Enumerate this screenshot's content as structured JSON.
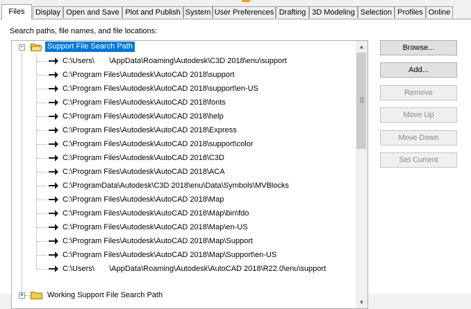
{
  "tabs": [
    {
      "label": "Files",
      "active": true
    },
    {
      "label": "Display"
    },
    {
      "label": "Open and Save"
    },
    {
      "label": "Plot and Publish"
    },
    {
      "label": "System"
    },
    {
      "label": "User Preferences"
    },
    {
      "label": "Drafting"
    },
    {
      "label": "3D Modeling"
    },
    {
      "label": "Selection"
    },
    {
      "label": "Profiles"
    },
    {
      "label": "Online"
    }
  ],
  "panel": {
    "label": "Search paths, file names, and file locations:"
  },
  "tree": {
    "root": {
      "label": "Support File Search Path",
      "expanded": true,
      "selected": true
    },
    "paths": [
      "C:\\Users\\       \\AppData\\Roaming\\Autodesk\\C3D 2018\\enu\\support",
      "C:\\Program Files\\Autodesk\\AutoCAD 2018\\support",
      "C:\\Program Files\\Autodesk\\AutoCAD 2018\\support\\en-US",
      "C:\\Program Files\\Autodesk\\AutoCAD 2018\\fonts",
      "C:\\Program Files\\Autodesk\\AutoCAD 2018\\help",
      "C:\\Program Files\\Autodesk\\AutoCAD 2018\\Express",
      "C:\\Program Files\\Autodesk\\AutoCAD 2018\\support\\color",
      "C:\\Program Files\\Autodesk\\AutoCAD 2018\\C3D",
      "C:\\Program Files\\Autodesk\\AutoCAD 2018\\ACA",
      "C:\\ProgramData\\Autodesk\\C3D 2018\\enu\\Data\\Symbols\\MVBlocks",
      "C:\\Program Files\\Autodesk\\AutoCAD 2018\\Map",
      "C:\\Program Files\\Autodesk\\AutoCAD 2018\\Map\\bin\\fdo",
      "C:\\Program Files\\Autodesk\\AutoCAD 2018\\Map\\en-US",
      "C:\\Program Files\\Autodesk\\AutoCAD 2018\\Map\\Support",
      "C:\\Program Files\\Autodesk\\AutoCAD 2018\\Map\\Support\\en-US",
      "C:\\Users\\       \\AppData\\Roaming\\Autodesk\\AutoCAD 2018\\R22.0\\enu\\support"
    ],
    "next_group": {
      "label": "Working Support File Search Path",
      "expanded": false
    }
  },
  "buttons": [
    {
      "label": "Browse...",
      "enabled": true
    },
    {
      "label": "Add...",
      "enabled": true
    },
    {
      "label": "Remove",
      "enabled": false
    },
    {
      "label": "Move Up",
      "enabled": false
    },
    {
      "label": "Move Down",
      "enabled": false
    },
    {
      "label": "Set Current",
      "enabled": false
    }
  ],
  "colors": {
    "selection": "#0078d7",
    "folder": "#f2c94c"
  }
}
